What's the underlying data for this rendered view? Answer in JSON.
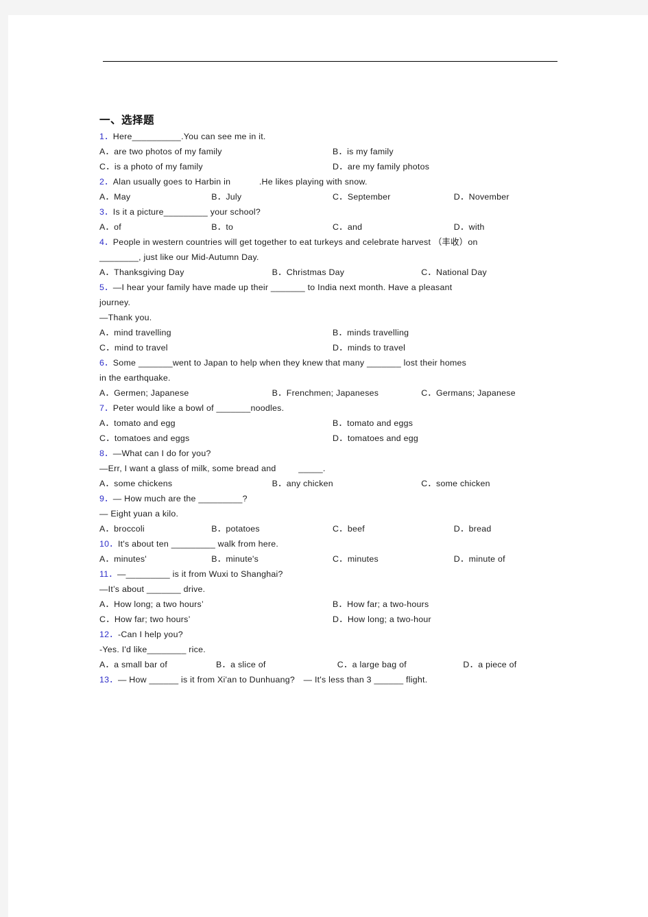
{
  "document": {
    "section_heading": "一、选择题",
    "items": [
      {
        "num": "1．",
        "stem": "Here__________.You can see me in it.",
        "layout": "two",
        "options": [
          "A．are two photos of my family",
          "B．is my family",
          "C．is a photo of my family",
          "D．are my family photos"
        ]
      },
      {
        "num": "2．",
        "stem": "Alan usually goes to Harbin in　　　 .He likes playing with snow.",
        "layout": "four",
        "options": [
          "A．May",
          "B．July",
          "C．September",
          "D．November"
        ]
      },
      {
        "num": "3．",
        "stem": "Is it a picture_________ your school?",
        "layout": "four",
        "options": [
          "A．of",
          "B．to",
          "C．and",
          "D．with"
        ]
      },
      {
        "num": "4．",
        "stem": "People in western countries will get together to eat turkeys and celebrate harvest （丰收）on",
        "stem_cont": "________, just like our Mid-Autumn Day.",
        "layout": "three",
        "options": [
          "A．Thanksgiving Day",
          "B．Christmas Day",
          "C．National Day"
        ]
      },
      {
        "num": "5．",
        "stem": "—I hear your family have made up their _______ to India next month. Have a pleasant",
        "stem_cont": "journey.",
        "stem_cont2": "—Thank you.",
        "layout": "two",
        "options": [
          "A．mind travelling",
          "B．minds travelling",
          "C．mind to travel",
          "D．minds to travel"
        ]
      },
      {
        "num": "6．",
        "stem": "Some _______went to Japan to help when they knew that many _______ lost their homes",
        "stem_cont": "in the earthquake.",
        "layout": "three",
        "options": [
          "A．Germen; Japanese",
          "B．Frenchmen; Japaneses",
          "C．Germans; Japanese"
        ]
      },
      {
        "num": "7．",
        "stem": "Peter would like a bowl of _______noodles.",
        "layout": "two",
        "options": [
          "A．tomato and egg",
          "B．tomato and eggs",
          "C．tomatoes and eggs",
          "D．tomatoes and egg"
        ]
      },
      {
        "num": "8．",
        "stem": "—What can I do for you?",
        "stem_cont": "—Err, I want a glass of milk, some bread and 　　 _____.",
        "layout": "three",
        "options": [
          "A．some chickens",
          "B．any chicken",
          "C．some chicken"
        ]
      },
      {
        "num": "9．",
        "stem": "— How much are the _________?",
        "stem_cont": "— Eight yuan a kilo.",
        "layout": "four",
        "options": [
          "A．broccoli",
          "B．potatoes",
          "C．beef",
          "D．bread"
        ]
      },
      {
        "num": "10．",
        "stem": "It's about ten _________ walk from here.",
        "layout": "four",
        "options": [
          "A．minutes'",
          "B．minute's",
          "C．minutes",
          "D．minute of"
        ]
      },
      {
        "num": "11．",
        "stem": "—_________ is it from Wuxi to Shanghai?",
        "stem_cont": "—It’s about _______ drive.",
        "layout": "two",
        "options": [
          "A．How long; a two hours’",
          "B．How far; a two-hours",
          "C．How far; two hours’",
          "D．How long; a two-hour"
        ]
      },
      {
        "num": "12．",
        "stem": "-Can I help you?",
        "stem_cont": "-Yes. I'd like________ rice.",
        "layout": "fourA",
        "options": [
          "A．a small bar of",
          "B．a slice of",
          "C．a large bag of",
          "D．a piece of"
        ]
      },
      {
        "num": "13．",
        "stem": "— How ______ is it from Xi'an to Dunhuang?　— It's less than 3 ______ flight.",
        "layout": "none",
        "options": []
      }
    ]
  },
  "colors": {
    "question_number": "#2c2cc8",
    "body_text": "#1b1b1b",
    "page_background": "#ffffff",
    "canvas_background": "#f4f4f4"
  }
}
